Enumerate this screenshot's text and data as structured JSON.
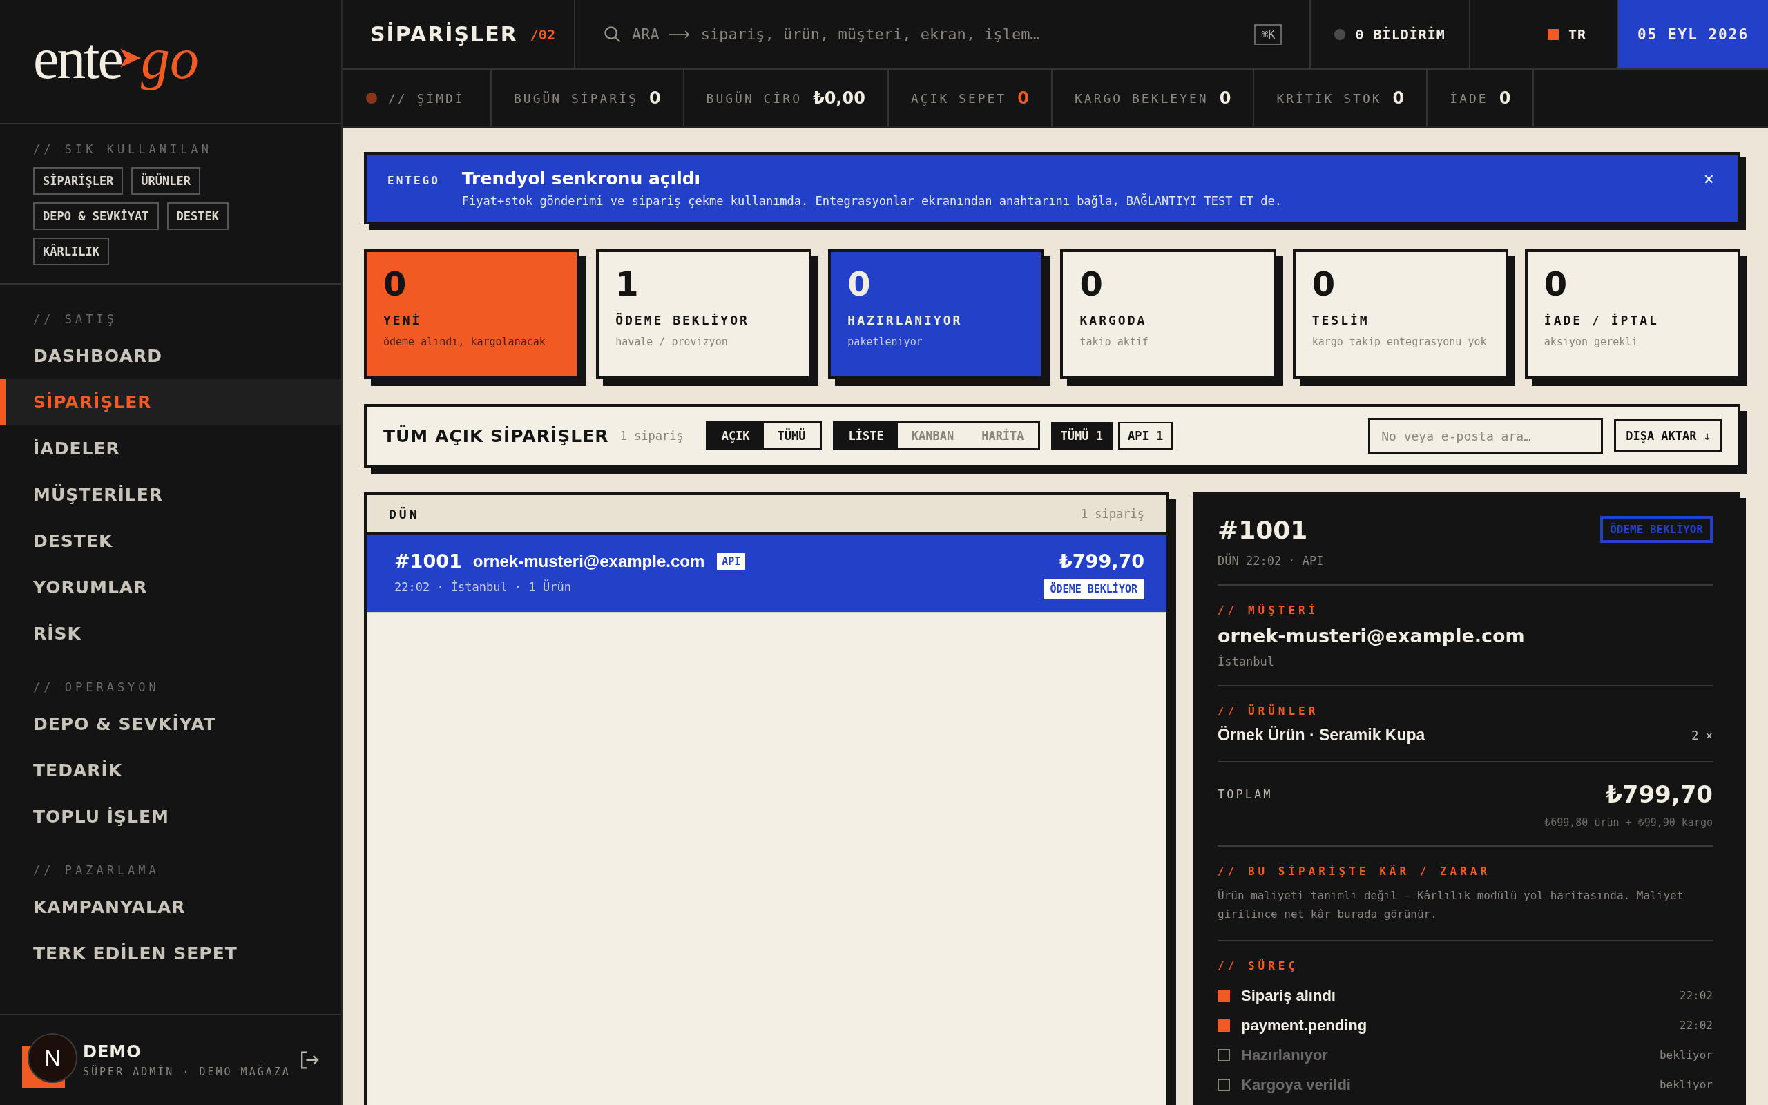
{
  "logo": {
    "word": "ente",
    "accent": "go"
  },
  "sidebar": {
    "favorites": {
      "label": "// SIK KULLANILAN",
      "chips": [
        "SİPARİŞLER",
        "ÜRÜNLER",
        "DEPO & SEVKİYAT",
        "DESTEK",
        "KÂRLILIK"
      ]
    },
    "sections": [
      {
        "label": "// SATIŞ",
        "items": [
          {
            "label": "DASHBOARD",
            "selected": false
          },
          {
            "label": "SİPARİŞLER",
            "selected": true
          },
          {
            "label": "İADELER",
            "selected": false
          },
          {
            "label": "MÜŞTERİLER",
            "selected": false
          },
          {
            "label": "DESTEK",
            "selected": false
          },
          {
            "label": "YORUMLAR",
            "selected": false
          },
          {
            "label": "RİSK",
            "selected": false
          }
        ]
      },
      {
        "label": "// OPERASYON",
        "items": [
          {
            "label": "DEPO & SEVKİYAT",
            "selected": false
          },
          {
            "label": "TEDARİK",
            "selected": false
          },
          {
            "label": "TOPLU İŞLEM",
            "selected": false
          }
        ]
      },
      {
        "label": "// PAZARLAMA",
        "items": [
          {
            "label": "KAMPANYALAR",
            "selected": false
          },
          {
            "label": "TERK EDİLEN SEPET",
            "selected": false
          }
        ]
      }
    ]
  },
  "user": {
    "initial": "N",
    "name": "DEMO",
    "role": "SÜPER ADMİN · DEMO MAĞAZA"
  },
  "topbar": {
    "title": "SİPARİŞLER",
    "page": "/02",
    "search": {
      "prefix": "ARA",
      "placeholder": "sipariş, ürün, müşteri, ekran, işlem…",
      "shortcut": "⌘K"
    },
    "notifications": "0 BİLDİRİM",
    "language": "TR",
    "date": "05 EYL 2026"
  },
  "ticker": {
    "label": "// ŞİMDİ",
    "stats": [
      {
        "label": "BUGÜN SİPARİŞ",
        "value": "0",
        "highlight": false
      },
      {
        "label": "BUGÜN CİRO",
        "value": "₺0,00",
        "highlight": false
      },
      {
        "label": "AÇIK SEPET",
        "value": "0",
        "highlight": true
      },
      {
        "label": "KARGO BEKLEYEN",
        "value": "0",
        "highlight": false
      },
      {
        "label": "KRİTİK STOK",
        "value": "0",
        "highlight": false
      },
      {
        "label": "İADE",
        "value": "0",
        "highlight": false
      }
    ]
  },
  "banner": {
    "source": "ENTEGO",
    "title": "Trendyol senkronu açıldı",
    "message": "Fiyat+stok gönderimi ve sipariş çekme kullanımda. Entegrasyonlar ekranından anahtarını bağla, BAĞLANTIYI TEST ET de.",
    "close": "×"
  },
  "status_cards": [
    {
      "count": "0",
      "label": "YENİ",
      "note": "ödeme alındı, kargolanacak",
      "kind": "alert"
    },
    {
      "count": "1",
      "label": "ÖDEME BEKLİYOR",
      "note": "havale / provizyon",
      "kind": "plain"
    },
    {
      "count": "0",
      "label": "HAZIRLANIYOR",
      "note": "paketleniyor",
      "kind": "active"
    },
    {
      "count": "0",
      "label": "KARGODA",
      "note": "takip aktif",
      "kind": "plain"
    },
    {
      "count": "0",
      "label": "TESLİM",
      "note": "kargo takip entegrasyonu yok",
      "kind": "plain"
    },
    {
      "count": "0",
      "label": "İADE / İPTAL",
      "note": "aksiyon gerekli",
      "kind": "plain"
    }
  ],
  "filter_bar": {
    "title": "TÜM AÇIK SİPARİŞLER",
    "count": "1 sipariş",
    "scope": [
      {
        "label": "AÇIK",
        "selected": true
      },
      {
        "label": "TÜMÜ",
        "selected": false
      }
    ],
    "views": [
      {
        "label": "LİSTE",
        "selected": true
      },
      {
        "label": "KANBAN",
        "selected": false
      },
      {
        "label": "HARİTA",
        "selected": false
      }
    ],
    "sources": [
      {
        "label": "TÜMÜ 1",
        "selected": true
      },
      {
        "label": "API 1",
        "selected": false
      }
    ],
    "search": {
      "placeholder": "No veya e-posta ara…"
    },
    "export": "DIŞA AKTAR ↓"
  },
  "order_groups": [
    {
      "label": "DÜN",
      "count": "1 sipariş",
      "orders": [
        {
          "number": "#1001",
          "customer": "ornek-musteri@example.com",
          "source": "API",
          "meta": "22:02 · İstanbul · 1 Ürün",
          "total": "₺799,70",
          "status": "ÖDEME BEKLİYOR",
          "selected": true
        }
      ]
    }
  ],
  "detail": {
    "number": "#1001",
    "meta": "DÜN 22:02 · API",
    "status": "ÖDEME BEKLİYOR",
    "customer": {
      "label": "// MÜŞTERİ",
      "email": "ornek-musteri@example.com",
      "city": "İstanbul"
    },
    "products": {
      "label": "// ÜRÜNLER",
      "items": [
        {
          "name": "Örnek Ürün · Seramik Kupa",
          "qty": "2 ×"
        }
      ]
    },
    "total": {
      "label": "TOPLAM",
      "amount": "₺799,70",
      "breakdown": "₺699,80 ürün + ₺99,90 kargo"
    },
    "profit": {
      "label": "// BU SİPARİŞTE KÂR / ZARAR",
      "note": "Ürün maliyeti tanımlı değil — Kârlılık modülü yol haritasında. Maliyet girilince net kâr burada görünür."
    },
    "process": {
      "label": "// SÜREÇ",
      "steps": [
        {
          "label": "Sipariş alındı",
          "time": "22:02",
          "done": true
        },
        {
          "label": "payment.pending",
          "time": "22:02",
          "done": true
        },
        {
          "label": "Hazırlanıyor",
          "time": "bekliyor",
          "done": false
        },
        {
          "label": "Kargoya verildi",
          "time": "bekliyor",
          "done": false
        }
      ]
    }
  }
}
